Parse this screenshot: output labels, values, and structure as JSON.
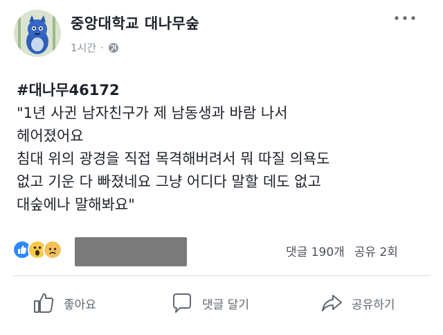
{
  "header": {
    "page_name": "중앙대학교 대나무숲",
    "time": "1시간",
    "more_icon": "more-horizontal-icon",
    "audience_icon": "globe-icon"
  },
  "post": {
    "hashtag": "#대나무46172",
    "lines": [
      "\"1년 사귄 남자친구가 제 남동생과 바람 나서",
      "헤어졌어요",
      "침대 위의 광경을 직접 목격해버려서 뭐 따질 의욕도",
      "없고 기운 다 빠졌네요 그냥 어디다 말할 데도 없고",
      "대숲에나 말해봐요\""
    ]
  },
  "stats": {
    "comments": "댓글 190개",
    "shares": "공유 2회"
  },
  "actions": {
    "like": "좋아요",
    "comment": "댓글 달기",
    "share": "공유하기"
  }
}
